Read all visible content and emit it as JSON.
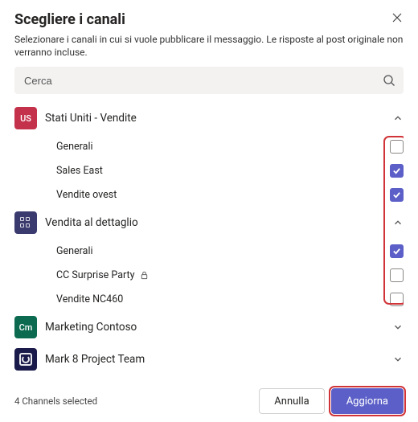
{
  "dialog": {
    "title": "Scegliere i canali",
    "subtitle": "Selezionare i canali in cui si vuole pubblicare il messaggio. Le risposte al post originale non verranno incluse."
  },
  "search": {
    "placeholder": "Cerca"
  },
  "teams": {
    "us": {
      "name": "Stati Uniti - Vendite",
      "avatar_label": "US",
      "channels": {
        "generali": "Generali",
        "sales_east": "Sales East",
        "vendite_ovest": "Vendite ovest"
      }
    },
    "retail": {
      "name": "Vendita al dettaglio",
      "channels": {
        "generali": "Generali",
        "cc": "CC Surprise Party",
        "nc460": "Vendite NC460"
      }
    },
    "cm": {
      "name": "Marketing Contoso",
      "avatar_label": "Cm"
    },
    "mk8": {
      "name": "Mark 8 Project Team"
    }
  },
  "footer": {
    "status": "4 Channels selected",
    "cancel": "Annulla",
    "primary": "Aggiorna"
  },
  "colors": {
    "accent": "#5b5fc7",
    "danger_highlight": "#d13438"
  },
  "state": {
    "checked": {
      "us_generali": false,
      "us_sales_east": true,
      "us_vendite_ovest": true,
      "retail_generali": true,
      "retail_cc": false,
      "retail_nc460": false
    }
  }
}
